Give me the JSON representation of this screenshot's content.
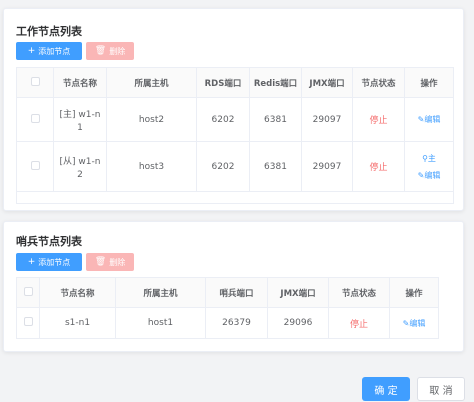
{
  "work_nodes": {
    "title": "工作节点列表",
    "add_label": "添加节点",
    "delete_label": "删除",
    "headers": [
      "",
      "节点名称",
      "所属主机",
      "RDS端口",
      "Redis端口",
      "JMX端口",
      "节点状态",
      "操作"
    ],
    "rows": [
      {
        "name_line1": "[主] w1-n",
        "name_line2": "1",
        "host": "host2",
        "rds": "6202",
        "redis": "6381",
        "jmx": "29097",
        "status": "停止",
        "op_edit": "编辑",
        "op_master": ""
      },
      {
        "name_line1": "[从] w1-n",
        "name_line2": "2",
        "host": "host3",
        "rds": "6202",
        "redis": "6381",
        "jmx": "29097",
        "status": "停止",
        "op_edit": "编辑",
        "op_master": "主"
      }
    ]
  },
  "sentinel_nodes": {
    "title": "哨兵节点列表",
    "add_label": "添加节点",
    "delete_label": "删除",
    "headers": [
      "",
      "节点名称",
      "所属主机",
      "哨兵端口",
      "JMX端口",
      "节点状态",
      "操作"
    ],
    "rows": [
      {
        "name": "s1-n1",
        "host": "host1",
        "sentinel": "26379",
        "jmx": "29096",
        "status": "停止",
        "op_edit": "编辑"
      }
    ]
  },
  "dialog": {
    "confirm_label": "确 定",
    "cancel_label": "取 消"
  },
  "colors": {
    "primary": "#409eff",
    "danger_light": "#fab6b6",
    "stopped": "#f56c6c"
  },
  "icons": {
    "add": "plus-icon",
    "delete": "trash-icon",
    "edit": "edit-icon",
    "master": "pin-icon"
  }
}
